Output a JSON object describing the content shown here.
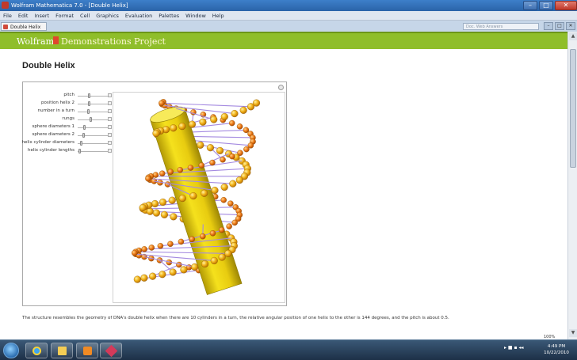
{
  "window": {
    "title": "Wolfram Mathematica 7.0 - [Double Helix]"
  },
  "menu": [
    "File",
    "Edit",
    "Insert",
    "Format",
    "Cell",
    "Graphics",
    "Evaluation",
    "Palettes",
    "Window",
    "Help"
  ],
  "doc_tab": {
    "label": "Double Helix"
  },
  "search": {
    "placeholder": "Doc. Web Answers"
  },
  "banner": {
    "brand_part1": "Wolfram",
    "brand_part2": "Demonstrations Project"
  },
  "page_title": "Double Helix",
  "controls": [
    {
      "label": "pitch",
      "value": 0.37
    },
    {
      "label": "position helix 2",
      "value": 0.37
    },
    {
      "label": "number in a turn",
      "value": 0.33
    },
    {
      "label": "rungs",
      "value": 0.43
    },
    {
      "label": "sphere diameters 1",
      "value": 0.2
    },
    {
      "label": "sphere diameters 2",
      "value": 0.17
    },
    {
      "label": "helix cylinder diameters",
      "value": 0.07
    },
    {
      "label": "helix cylinder lengths",
      "value": 0.02
    }
  ],
  "caption": "The structure resembles the geometry of DNA's double helix when there are 10 cylinders in a turn, the relative angular position of one helix to the other is 144 degrees, and the pitch is about 0.5.",
  "zoom": "100%",
  "clock": {
    "time": "4:49 PM",
    "date": "10/22/2010"
  },
  "colors": {
    "banner": "#8fbe2a",
    "rod": "#e6cf12",
    "helix_front": "#f2b31a",
    "helix_back": "#f07d1a",
    "rung": "#a48ae0"
  }
}
